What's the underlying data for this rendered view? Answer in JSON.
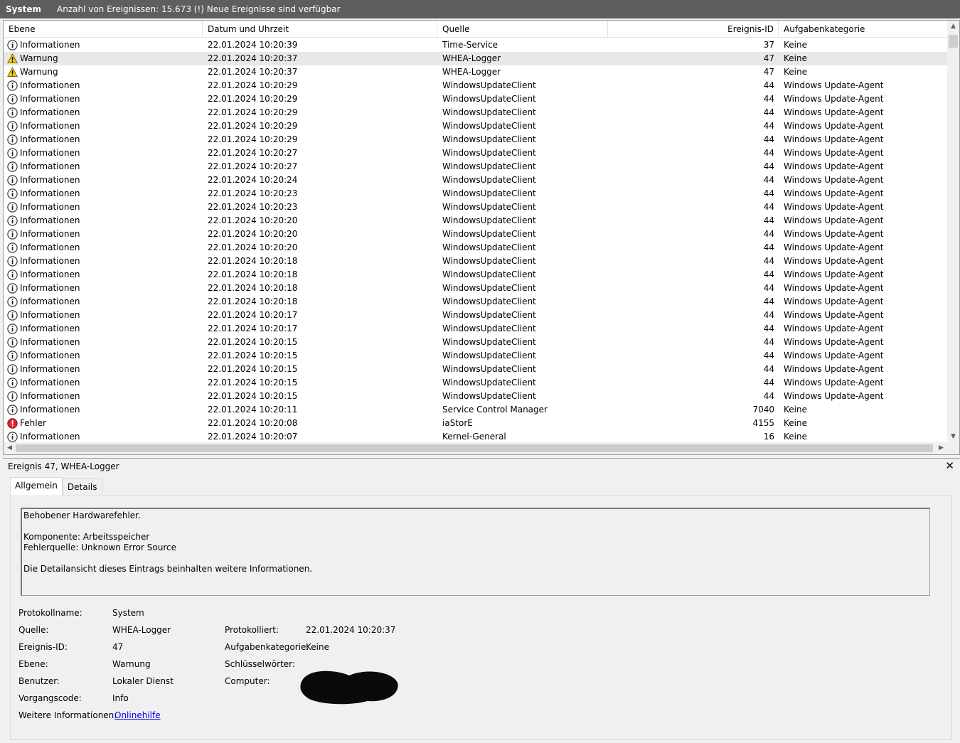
{
  "titlebar": {
    "log_name": "System",
    "event_count_text": "Anzahl von Ereignissen: 15.673 (!) Neue Ereignisse sind verfügbar"
  },
  "columns": [
    "Ebene",
    "Datum und Uhrzeit",
    "Quelle",
    "Ereignis-ID",
    "Aufgabenkategorie"
  ],
  "events": [
    {
      "level": "Informationen",
      "icon": "info-icon",
      "datetime": "22.01.2024 10:20:39",
      "source": "Time-Service",
      "id": "37",
      "category": "Keine"
    },
    {
      "level": "Warnung",
      "icon": "warning-icon",
      "datetime": "22.01.2024 10:20:37",
      "source": "WHEA-Logger",
      "id": "47",
      "category": "Keine",
      "selected": true
    },
    {
      "level": "Warnung",
      "icon": "warning-icon",
      "datetime": "22.01.2024 10:20:37",
      "source": "WHEA-Logger",
      "id": "47",
      "category": "Keine"
    },
    {
      "level": "Informationen",
      "icon": "info-icon",
      "datetime": "22.01.2024 10:20:29",
      "source": "WindowsUpdateClient",
      "id": "44",
      "category": "Windows Update-Agent"
    },
    {
      "level": "Informationen",
      "icon": "info-icon",
      "datetime": "22.01.2024 10:20:29",
      "source": "WindowsUpdateClient",
      "id": "44",
      "category": "Windows Update-Agent"
    },
    {
      "level": "Informationen",
      "icon": "info-icon",
      "datetime": "22.01.2024 10:20:29",
      "source": "WindowsUpdateClient",
      "id": "44",
      "category": "Windows Update-Agent"
    },
    {
      "level": "Informationen",
      "icon": "info-icon",
      "datetime": "22.01.2024 10:20:29",
      "source": "WindowsUpdateClient",
      "id": "44",
      "category": "Windows Update-Agent"
    },
    {
      "level": "Informationen",
      "icon": "info-icon",
      "datetime": "22.01.2024 10:20:29",
      "source": "WindowsUpdateClient",
      "id": "44",
      "category": "Windows Update-Agent"
    },
    {
      "level": "Informationen",
      "icon": "info-icon",
      "datetime": "22.01.2024 10:20:27",
      "source": "WindowsUpdateClient",
      "id": "44",
      "category": "Windows Update-Agent"
    },
    {
      "level": "Informationen",
      "icon": "info-icon",
      "datetime": "22.01.2024 10:20:27",
      "source": "WindowsUpdateClient",
      "id": "44",
      "category": "Windows Update-Agent"
    },
    {
      "level": "Informationen",
      "icon": "info-icon",
      "datetime": "22.01.2024 10:20:24",
      "source": "WindowsUpdateClient",
      "id": "44",
      "category": "Windows Update-Agent"
    },
    {
      "level": "Informationen",
      "icon": "info-icon",
      "datetime": "22.01.2024 10:20:23",
      "source": "WindowsUpdateClient",
      "id": "44",
      "category": "Windows Update-Agent"
    },
    {
      "level": "Informationen",
      "icon": "info-icon",
      "datetime": "22.01.2024 10:20:23",
      "source": "WindowsUpdateClient",
      "id": "44",
      "category": "Windows Update-Agent"
    },
    {
      "level": "Informationen",
      "icon": "info-icon",
      "datetime": "22.01.2024 10:20:20",
      "source": "WindowsUpdateClient",
      "id": "44",
      "category": "Windows Update-Agent"
    },
    {
      "level": "Informationen",
      "icon": "info-icon",
      "datetime": "22.01.2024 10:20:20",
      "source": "WindowsUpdateClient",
      "id": "44",
      "category": "Windows Update-Agent"
    },
    {
      "level": "Informationen",
      "icon": "info-icon",
      "datetime": "22.01.2024 10:20:20",
      "source": "WindowsUpdateClient",
      "id": "44",
      "category": "Windows Update-Agent"
    },
    {
      "level": "Informationen",
      "icon": "info-icon",
      "datetime": "22.01.2024 10:20:18",
      "source": "WindowsUpdateClient",
      "id": "44",
      "category": "Windows Update-Agent"
    },
    {
      "level": "Informationen",
      "icon": "info-icon",
      "datetime": "22.01.2024 10:20:18",
      "source": "WindowsUpdateClient",
      "id": "44",
      "category": "Windows Update-Agent"
    },
    {
      "level": "Informationen",
      "icon": "info-icon",
      "datetime": "22.01.2024 10:20:18",
      "source": "WindowsUpdateClient",
      "id": "44",
      "category": "Windows Update-Agent"
    },
    {
      "level": "Informationen",
      "icon": "info-icon",
      "datetime": "22.01.2024 10:20:18",
      "source": "WindowsUpdateClient",
      "id": "44",
      "category": "Windows Update-Agent"
    },
    {
      "level": "Informationen",
      "icon": "info-icon",
      "datetime": "22.01.2024 10:20:17",
      "source": "WindowsUpdateClient",
      "id": "44",
      "category": "Windows Update-Agent"
    },
    {
      "level": "Informationen",
      "icon": "info-icon",
      "datetime": "22.01.2024 10:20:17",
      "source": "WindowsUpdateClient",
      "id": "44",
      "category": "Windows Update-Agent"
    },
    {
      "level": "Informationen",
      "icon": "info-icon",
      "datetime": "22.01.2024 10:20:15",
      "source": "WindowsUpdateClient",
      "id": "44",
      "category": "Windows Update-Agent"
    },
    {
      "level": "Informationen",
      "icon": "info-icon",
      "datetime": "22.01.2024 10:20:15",
      "source": "WindowsUpdateClient",
      "id": "44",
      "category": "Windows Update-Agent"
    },
    {
      "level": "Informationen",
      "icon": "info-icon",
      "datetime": "22.01.2024 10:20:15",
      "source": "WindowsUpdateClient",
      "id": "44",
      "category": "Windows Update-Agent"
    },
    {
      "level": "Informationen",
      "icon": "info-icon",
      "datetime": "22.01.2024 10:20:15",
      "source": "WindowsUpdateClient",
      "id": "44",
      "category": "Windows Update-Agent"
    },
    {
      "level": "Informationen",
      "icon": "info-icon",
      "datetime": "22.01.2024 10:20:15",
      "source": "WindowsUpdateClient",
      "id": "44",
      "category": "Windows Update-Agent"
    },
    {
      "level": "Informationen",
      "icon": "info-icon",
      "datetime": "22.01.2024 10:20:11",
      "source": "Service Control Manager",
      "id": "7040",
      "category": "Keine"
    },
    {
      "level": "Fehler",
      "icon": "error-icon",
      "datetime": "22.01.2024 10:20:08",
      "source": "iaStorE",
      "id": "4155",
      "category": "Keine"
    },
    {
      "level": "Informationen",
      "icon": "info-icon",
      "datetime": "22.01.2024 10:20:07",
      "source": "Kernel-General",
      "id": "16",
      "category": "Keine"
    }
  ],
  "detail": {
    "title": "Ereignis 47, WHEA-Logger",
    "tabs": [
      "Allgemein",
      "Details"
    ],
    "description": [
      "Behobener Hardwarefehler.",
      "",
      "Komponente: Arbeitsspeicher",
      "Fehlerquelle: Unknown Error Source",
      "",
      "Die Detailansicht dieses Eintrags beinhalten weitere Informationen."
    ],
    "props": {
      "log_label": "Protokollname:",
      "log_value": "System",
      "source_label": "Quelle:",
      "source_value": "WHEA-Logger",
      "logged_label": "Protokolliert:",
      "logged_value": "22.01.2024 10:20:37",
      "eventid_label": "Ereignis-ID:",
      "eventid_value": "47",
      "category_label": "Aufgabenkategorie:",
      "category_value": "Keine",
      "level_label": "Ebene:",
      "level_value": "Warnung",
      "keywords_label": "Schlüsselwörter:",
      "user_label": "Benutzer:",
      "user_value": "Lokaler Dienst",
      "computer_label": "Computer:",
      "opcode_label": "Vorgangscode:",
      "opcode_value": "Info",
      "moreinfo_label": "Weitere Informationen:",
      "moreinfo_link": "Onlinehilfe"
    }
  }
}
